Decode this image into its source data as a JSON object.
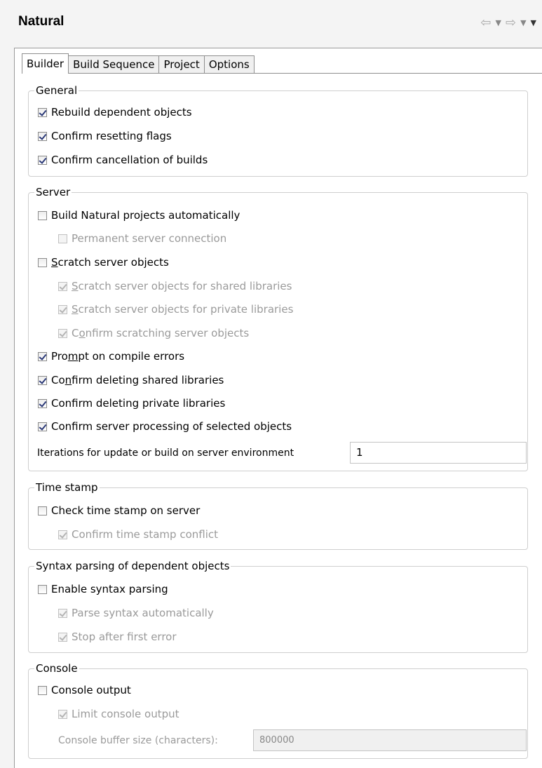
{
  "view": {
    "title": "Natural",
    "nav": {
      "back_icon": "arrow-left-icon",
      "forward_icon": "arrow-right-icon",
      "menu_icon": "chevron-down-icon"
    }
  },
  "tabs": [
    "Builder",
    "Build Sequence",
    "Project",
    "Options"
  ],
  "active_tab": "Builder",
  "general": {
    "legend": "General",
    "rebuild_dependent": {
      "label": "Rebuild dependent objects",
      "checked": true
    },
    "confirm_reset_flags": {
      "label": "Confirm resetting flags",
      "checked": true
    },
    "confirm_cancel_builds": {
      "label": "Confirm cancellation of builds",
      "checked": true
    }
  },
  "server": {
    "legend": "Server",
    "build_auto": {
      "label": "Build Natural projects automatically",
      "checked": false
    },
    "permanent_conn": {
      "label": "Permanent server connection",
      "checked": false,
      "enabled": false
    },
    "scratch_objects": {
      "label_pre": "",
      "label_mn": "S",
      "label_post": "cratch server objects",
      "checked": false
    },
    "scratch_shared": {
      "label_pre": "",
      "label_mn": "S",
      "label_post": "cratch server objects for shared libraries",
      "checked": true,
      "enabled": false
    },
    "scratch_private": {
      "label_pre": "",
      "label_mn": "S",
      "label_post": "cratch server objects for private libraries",
      "checked": true,
      "enabled": false
    },
    "confirm_scratch": {
      "label_pre": "C",
      "label_mn": "o",
      "label_post": "nfirm scratching server objects",
      "checked": true,
      "enabled": false
    },
    "prompt_compile": {
      "label_pre": "Pro",
      "label_mn": "m",
      "label_post": "pt on compile errors",
      "checked": true
    },
    "confirm_del_shared": {
      "label_pre": "Co",
      "label_mn": "n",
      "label_post": "firm deleting shared libraries",
      "checked": true
    },
    "confirm_del_private": {
      "label": "Confirm deleting private libraries",
      "checked": true
    },
    "confirm_processing": {
      "label": "Confirm server processing of selected objects",
      "checked": true
    },
    "iterations": {
      "label": "Iterations for update or build on server environment",
      "value": "1"
    }
  },
  "timestamp": {
    "legend": "Time stamp",
    "check": {
      "label": "Check time stamp on server",
      "checked": false
    },
    "confirm_conflict": {
      "label": "Confirm time stamp conflict",
      "checked": true,
      "enabled": false
    }
  },
  "syntax": {
    "legend": "Syntax parsing of dependent objects",
    "enable": {
      "label": "Enable syntax parsing",
      "checked": false
    },
    "auto": {
      "label": "Parse syntax automatically",
      "checked": true,
      "enabled": false
    },
    "stop_first": {
      "label": "Stop after first error",
      "checked": true,
      "enabled": false
    }
  },
  "console": {
    "legend": "Console",
    "output": {
      "label": "Console output",
      "checked": false
    },
    "limit": {
      "label": "Limit console output",
      "checked": true,
      "enabled": false
    },
    "buffer": {
      "label": "Console buffer size (characters):",
      "value": "800000",
      "enabled": false
    }
  }
}
